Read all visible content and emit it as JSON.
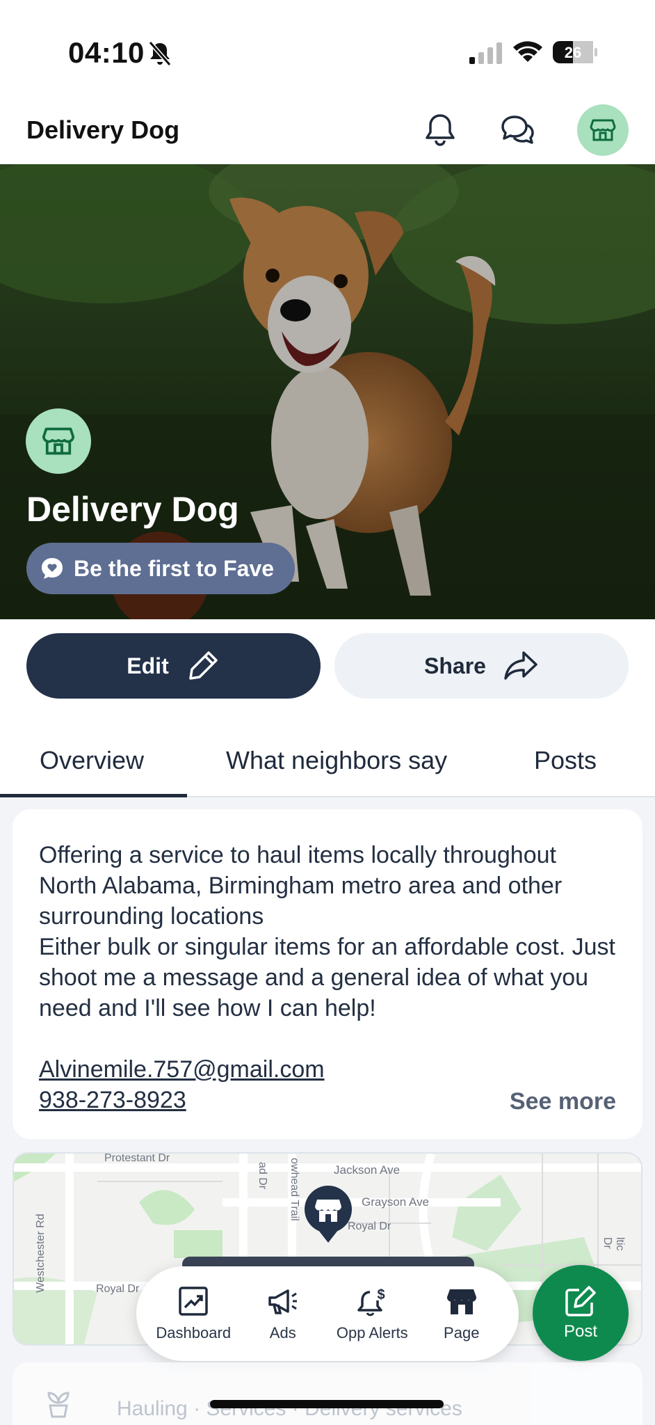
{
  "status_bar": {
    "time": "04:10",
    "battery_level": "26"
  },
  "header": {
    "title": "Delivery Dog"
  },
  "hero": {
    "business_name": "Delivery Dog",
    "fave_label": "Be the first to Fave"
  },
  "actions": {
    "edit_label": "Edit",
    "share_label": "Share"
  },
  "tabs": [
    {
      "label": "Overview",
      "active": true
    },
    {
      "label": "What neighbors say",
      "active": false
    },
    {
      "label": "Posts",
      "active": false
    }
  ],
  "about": {
    "description": "Offering a service to haul items locally throughout North Alabama, Birmingham metro area and other surrounding locations\nEither bulk or singular items for an affordable cost. Just shoot me a message and a general idea of what you need and I'll see how I can help!",
    "email": "Alvinemile.757@gmail.com",
    "phone": "938-273-8923",
    "see_more": "See more"
  },
  "map": {
    "streets": [
      "Protestant Dr",
      "Jackson Ave",
      "Grayson Ave",
      "Royal Dr",
      "Westchester Rd",
      "Royal Dr",
      "ad Dr",
      "owhead Trail",
      "ltic Dr"
    ]
  },
  "bottom_nav": [
    {
      "label": "Dashboard",
      "icon": "dashboard-chart-icon"
    },
    {
      "label": "Ads",
      "icon": "megaphone-icon"
    },
    {
      "label": "Opp Alerts",
      "icon": "bell-dollar-icon"
    },
    {
      "label": "Page",
      "icon": "storefront-icon"
    }
  ],
  "fab": {
    "label": "Post"
  },
  "peek": {
    "text": "Hauling · Services · Delivery services"
  },
  "colors": {
    "brand_dark": "#233149",
    "brand_green": "#0e8a4f",
    "avatar_green": "#a9e0bd",
    "fave_pill": "#5f6f93"
  }
}
